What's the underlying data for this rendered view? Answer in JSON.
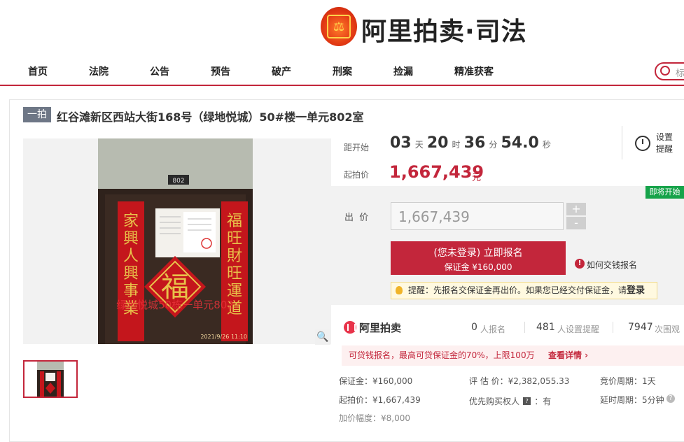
{
  "header": {
    "logo_icon": "court-seal-emblem",
    "logo_text": "阿里拍卖·司法",
    "nav": [
      "首页",
      "法院",
      "公告",
      "预告",
      "破产",
      "刑案",
      "捡漏",
      "精准获客"
    ],
    "search_placeholder": "标",
    "accent_color": "#c3263b"
  },
  "item": {
    "badge": "一拍",
    "title": "红谷滩新区西站大街168号（绿地悦城）50#楼一单元802室"
  },
  "gallery": {
    "main_photo": {
      "overlay_text": "绿地悦城50栋一单元802",
      "timestamp": "2021/9/26 11:10",
      "door_plate": "802",
      "left_scroll": "家兴人兴事业兴",
      "right_scroll": "福旺财旺运道旺",
      "center_char": "福"
    },
    "zoom_icon": "magnifier-icon"
  },
  "countdown": {
    "label": "距开始",
    "days": "03",
    "days_unit": "天",
    "hours": "20",
    "hours_unit": "时",
    "minutes": "36",
    "minutes_unit": "分",
    "seconds": "54.0",
    "seconds_unit": "秒"
  },
  "reminder": {
    "line1": "设置",
    "line2": "提醒"
  },
  "start_price": {
    "label": "起拍价",
    "value": "1,667,439",
    "unit": "元"
  },
  "bid": {
    "tag": "即将开始",
    "label": "出  价",
    "input_value": "1,667,439",
    "plus": "+",
    "minus": "-",
    "signup_line1": "(您未登录) 立即报名",
    "signup_line2": "保证金 ¥160,000",
    "how_to": "如何交钱报名",
    "tip_text": "提醒：先报名交保证金再出价。如果您已经交付保证金，请",
    "tip_login": "登录"
  },
  "stats": {
    "brand": "阿里拍卖",
    "signups": "0",
    "signups_label": "人报名",
    "reminders": "481",
    "reminders_label": "人设置提醒",
    "views": "7947",
    "views_label": "次围观"
  },
  "loan": {
    "text": "可贷钱报名，最高可贷保证金的70%，上限100万",
    "link": "查看详情 ›"
  },
  "info": {
    "deposit": "保证金：¥160,000",
    "appraisal": "评 估 价：¥2,382,055.33",
    "cycle": "竞价周期：1天",
    "start": "起拍价：¥1,667,439",
    "priority_label": "优先购买权人",
    "priority_value": "：有",
    "delay": "延时周期：5分钟",
    "increment": "加价幅度：¥8,000"
  }
}
